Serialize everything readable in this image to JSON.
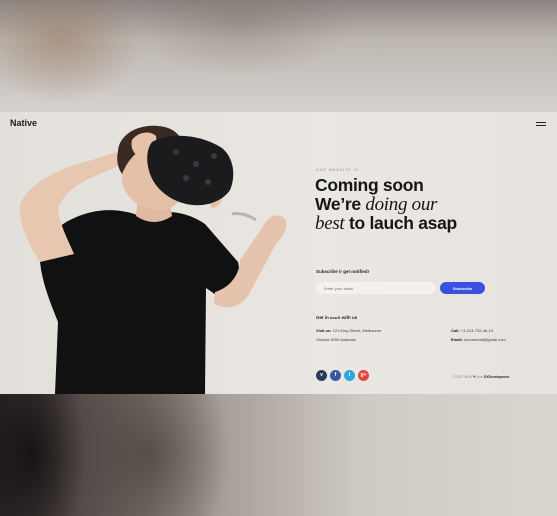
{
  "header": {
    "brand": "Native",
    "menu_icon": "hamburger-icon"
  },
  "hero": {
    "eyebrow": "OUR WEBSITE IS",
    "line1": "Coming soon",
    "line2_prefix": "We’re ",
    "line2_italic": "doing our",
    "line3_italic": "best",
    "line3_suffix": " to lauch asap"
  },
  "subscribe": {
    "label": "Subscribe ir get notified!",
    "email_placeholder": "Enter your email",
    "button_label": "Subscribe",
    "button_color": "#3b4fe0"
  },
  "contact": {
    "title_prefix": "Get in ",
    "title_italic": "touch",
    "title_suffix": " with us",
    "visit_label": "Visit us:",
    "visit_line1": "121 King Street, Melbourne",
    "visit_line2": "Victoria 3000 Australia",
    "call_label": "Call:",
    "call_value": "+1-213-732-46-19",
    "email_label": "Email:",
    "email_value": "someemail@gmail.com"
  },
  "socials": [
    {
      "name": "vimeo",
      "glyph": "v",
      "color": "#2d3b5a"
    },
    {
      "name": "facebook",
      "glyph": "f",
      "color": "#3b5a9d"
    },
    {
      "name": "twitter",
      "glyph": "t",
      "color": "#2fa6e0"
    },
    {
      "name": "google-plus",
      "glyph": "g+",
      "color": "#e0483c"
    }
  ],
  "footer": {
    "copyright_prefix": "© 2017 #INS",
    "heart_icon": "heart-icon",
    "by": " from ",
    "company": "DXDevelopment"
  }
}
